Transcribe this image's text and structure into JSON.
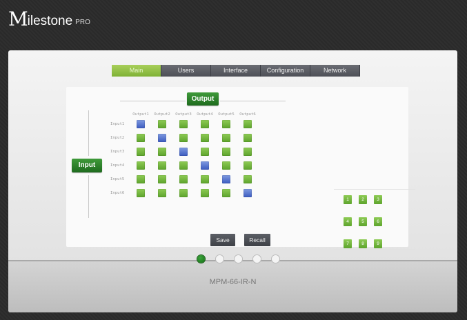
{
  "brand": {
    "mark": "M",
    "name": "ilestone",
    "suffix": "PRO"
  },
  "tabs": [
    "Main",
    "Users",
    "Interface",
    "Configuration",
    "Network"
  ],
  "active_tab": "Main",
  "matrix": {
    "output_button": "Output",
    "input_button": "Input",
    "outputs": [
      "Output1",
      "Output2",
      "Output3",
      "Output4",
      "Output5",
      "Output6"
    ],
    "inputs": [
      "Input1",
      "Input2",
      "Input3",
      "Input4",
      "Input5",
      "Input6"
    ],
    "selected_input_for_output": [
      1,
      2,
      3,
      4,
      5,
      6
    ]
  },
  "presets": [
    "1",
    "2",
    "3",
    "4",
    "5",
    "6",
    "7",
    "8",
    "9"
  ],
  "actions": {
    "save": "Save",
    "recall": "Recall"
  },
  "pager": {
    "pages": 5,
    "active": 1
  },
  "model": "MPM-66-IR-N",
  "colors": {
    "route_on": "#3b5bbf",
    "route_off": "#5da32c",
    "active_tab": "#8cc043",
    "button_green": "#2a7d28"
  }
}
